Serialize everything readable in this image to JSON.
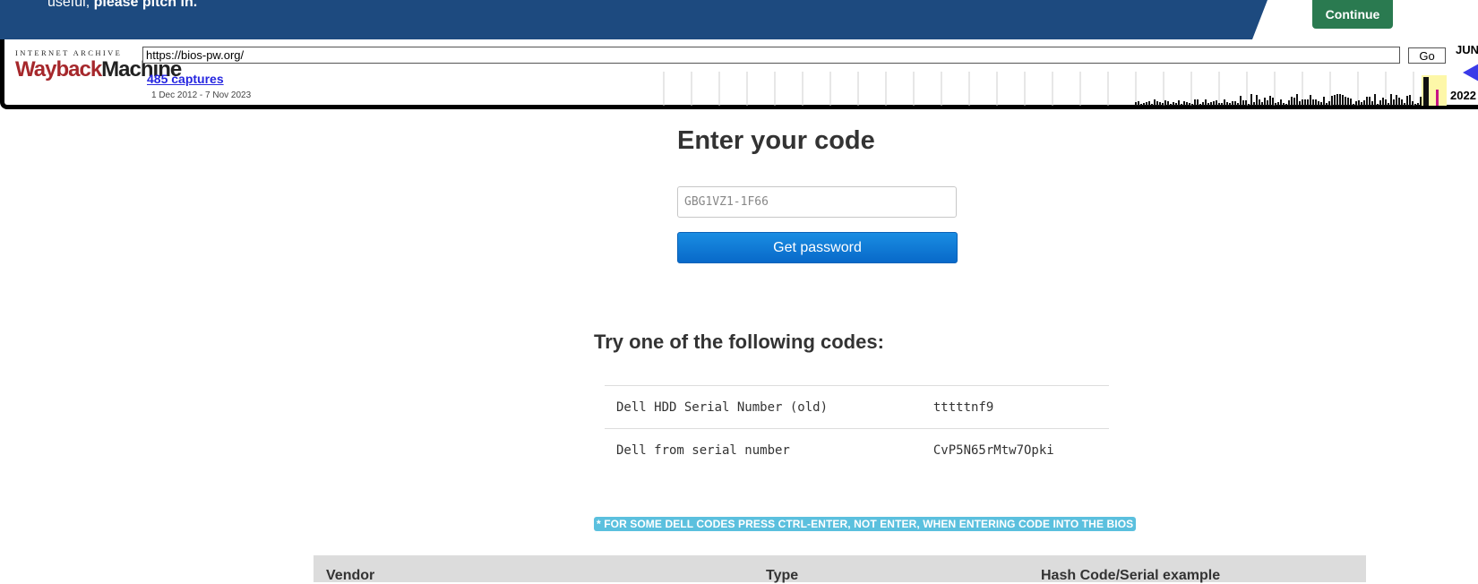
{
  "banner": {
    "text_normal": "useful, ",
    "text_bold": "please pitch in.",
    "continue_label": "Continue"
  },
  "wayback": {
    "logo_top": "INTERNET ARCHIVE",
    "logo_main_1": "Wayback",
    "logo_main_2": "Machine",
    "url": "https://bios-pw.org/",
    "go_label": "Go",
    "captures_label": "485 captures",
    "date_range": "1 Dec 2012 - 7 Nov 2023",
    "month": "JUN",
    "year": "2022"
  },
  "main": {
    "heading": "Enter your code",
    "code_placeholder": "GBG1VZ1-1F66",
    "get_password_label": "Get password",
    "try_heading": "Try one of the following codes:",
    "codes": [
      {
        "name": "Dell HDD Serial Number (old)",
        "code": "tttttnf9"
      },
      {
        "name": "Dell from serial number",
        "code": "CvP5N65rMtw7Opki"
      }
    ],
    "note": "* FOR SOME DELL CODES PRESS CTRL-ENTER, NOT ENTER, WHEN ENTERING CODE INTO THE BIOS",
    "table_headers": [
      "Vendor",
      "Type",
      "Hash Code/Serial example"
    ]
  },
  "colors": {
    "banner_blue": "#1d4a7f",
    "continue_green": "#2a7a50",
    "button_blue": "#0a75d6",
    "note_cyan": "#5bc0de"
  }
}
